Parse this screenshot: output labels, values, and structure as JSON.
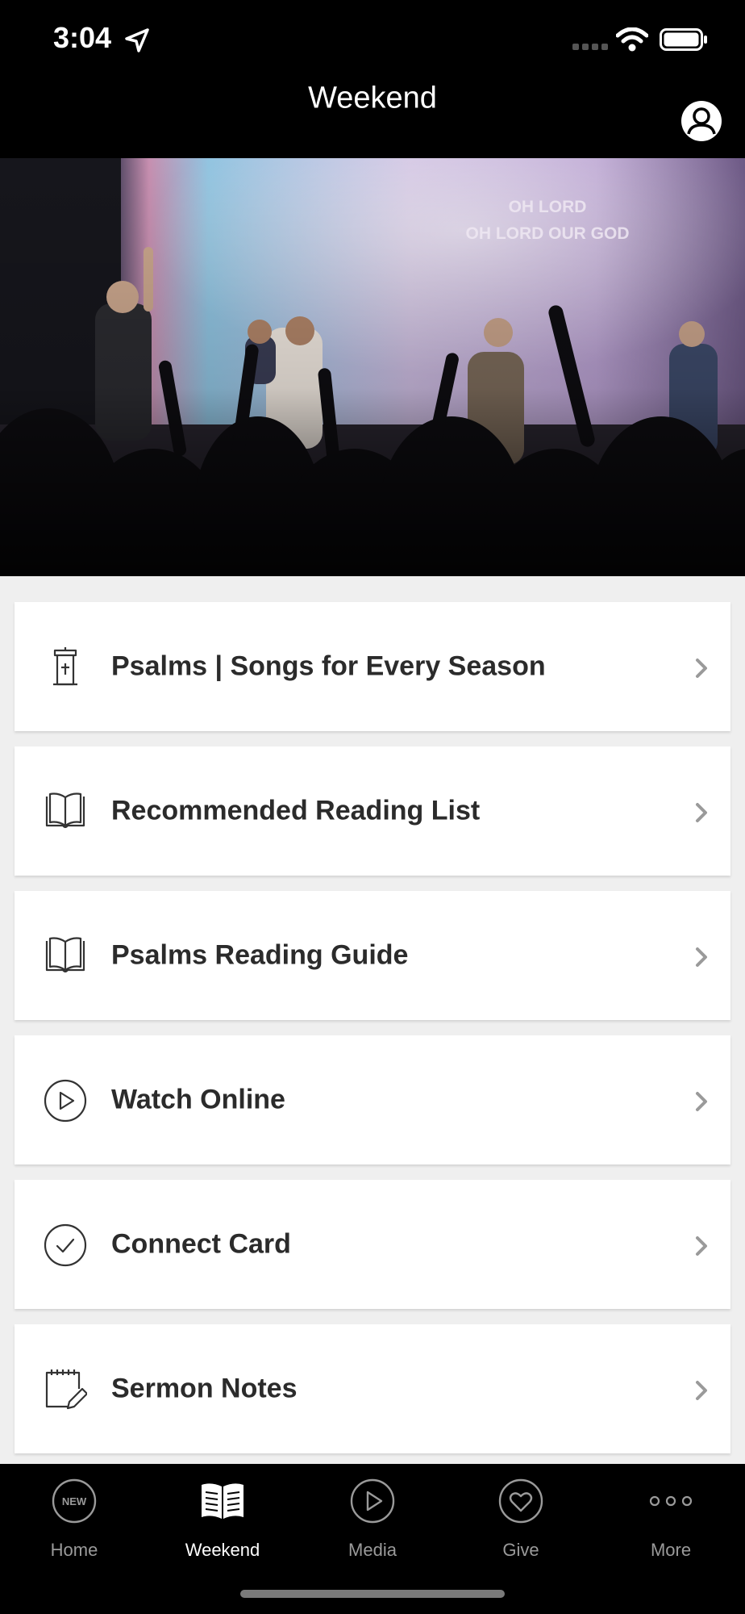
{
  "status_bar": {
    "time": "3:04"
  },
  "nav": {
    "title": "Weekend"
  },
  "hero": {
    "lyrics_line1": "OH LORD",
    "lyrics_line2": "OH LORD OUR GOD"
  },
  "menu": {
    "items": [
      {
        "label": "Psalms | Songs for Every Season",
        "icon": "pulpit-icon"
      },
      {
        "label": "Recommended Reading List",
        "icon": "open-book-icon"
      },
      {
        "label": "Psalms Reading Guide",
        "icon": "open-book-icon"
      },
      {
        "label": "Watch Online",
        "icon": "play-circle-icon"
      },
      {
        "label": "Connect Card",
        "icon": "check-circle-icon"
      },
      {
        "label": "Sermon Notes",
        "icon": "notepad-pencil-icon"
      }
    ]
  },
  "tabbar": {
    "tabs": [
      {
        "label": "Home",
        "icon": "new-badge-icon",
        "active": false,
        "badge_text": "NEW"
      },
      {
        "label": "Weekend",
        "icon": "book-icon",
        "active": true
      },
      {
        "label": "Media",
        "icon": "play-circle-icon",
        "active": false
      },
      {
        "label": "Give",
        "icon": "heart-circle-icon",
        "active": false
      },
      {
        "label": "More",
        "icon": "more-dots-icon",
        "active": false
      }
    ]
  },
  "colors": {
    "bar_background": "#000000",
    "page_background": "#efefef",
    "tab_active": "#ffffff",
    "tab_inactive": "#9a9a9a",
    "label_text": "#2b2b2b"
  }
}
